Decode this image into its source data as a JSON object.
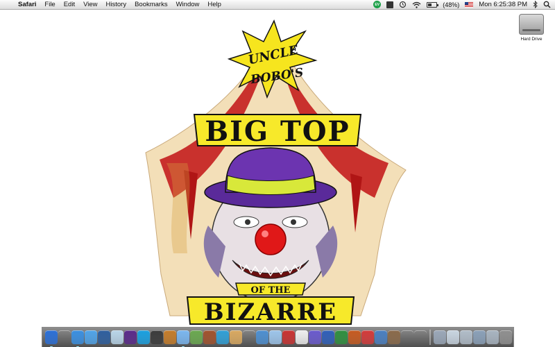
{
  "menubar": {
    "app_name": "Safari",
    "menus": [
      "File",
      "Edit",
      "View",
      "History",
      "Bookmarks",
      "Window",
      "Help"
    ],
    "status_icons": [
      "evernote-icon",
      "dropbox-icon",
      "time-machine-icon",
      "wifi-icon"
    ],
    "battery_percent": "(48%)",
    "battery_level": 0.48,
    "clock": "Mon 6:25:38 PM",
    "spotlight_icon": "magnifier-icon"
  },
  "desktop": {
    "hard_drive_label": "Hard Drive"
  },
  "wallpaper": {
    "line1": "UNCLE",
    "line2": "BOBO'S",
    "line3": "BIG TOP",
    "line4": "OF THE",
    "line5": "BIZARRE"
  },
  "dock": {
    "apps": [
      {
        "name": "finder-icon",
        "color": "#2b6fd6"
      },
      {
        "name": "dashboard-icon",
        "color": "#333"
      },
      {
        "name": "safari-icon",
        "color": "#3a8fe0"
      },
      {
        "name": "ichat-icon",
        "color": "#4fa3e8"
      },
      {
        "name": "facetime-icon",
        "color": "#2e5f9e"
      },
      {
        "name": "itunes-icon",
        "color": "#b8d4e8"
      },
      {
        "name": "app-icon",
        "color": "#5a2a8a"
      },
      {
        "name": "skype-icon",
        "color": "#1aa0e0"
      },
      {
        "name": "terminal-icon",
        "color": "#3b3b3b"
      },
      {
        "name": "guitar-icon",
        "color": "#c47c2a"
      },
      {
        "name": "itunes-icon",
        "color": "#7ab6ef"
      },
      {
        "name": "iphoto-icon",
        "color": "#6aa84f"
      },
      {
        "name": "photo-icon",
        "color": "#a0522d"
      },
      {
        "name": "flip-icon",
        "color": "#2f9fd6"
      },
      {
        "name": "user-icon",
        "color": "#d8a860"
      },
      {
        "name": "tools-icon",
        "color": "#777"
      },
      {
        "name": "system-icon",
        "color": "#4d8fd0"
      },
      {
        "name": "preview-icon",
        "color": "#9cc4ea"
      },
      {
        "name": "calendar-icon",
        "color": "#c83232"
      },
      {
        "name": "doc-icon",
        "color": "#eeeeee"
      },
      {
        "name": "app-icon",
        "color": "#6a5acd"
      },
      {
        "name": "word-icon",
        "color": "#2f5fb8"
      },
      {
        "name": "excel-icon",
        "color": "#2f8f3f"
      },
      {
        "name": "powerpoint-icon",
        "color": "#c65a20"
      },
      {
        "name": "app-icon",
        "color": "#d23a3a"
      },
      {
        "name": "window-icon",
        "color": "#4a7fc0"
      },
      {
        "name": "photo-icon",
        "color": "#8a6a4a"
      },
      {
        "name": "camera-icon",
        "color": "#555"
      },
      {
        "name": "app-icon",
        "color": "#888"
      }
    ],
    "docs": [
      {
        "name": "downloads-icon",
        "color": "#9aa7b8"
      },
      {
        "name": "folder-icon",
        "color": "#c8d4e0"
      },
      {
        "name": "folder-icon",
        "color": "#b0bcc8"
      },
      {
        "name": "folder-icon",
        "color": "#8aa0b8"
      },
      {
        "name": "folder-icon",
        "color": "#a8b4c0"
      },
      {
        "name": "trash-icon",
        "color": "#8f8f8f"
      }
    ]
  }
}
